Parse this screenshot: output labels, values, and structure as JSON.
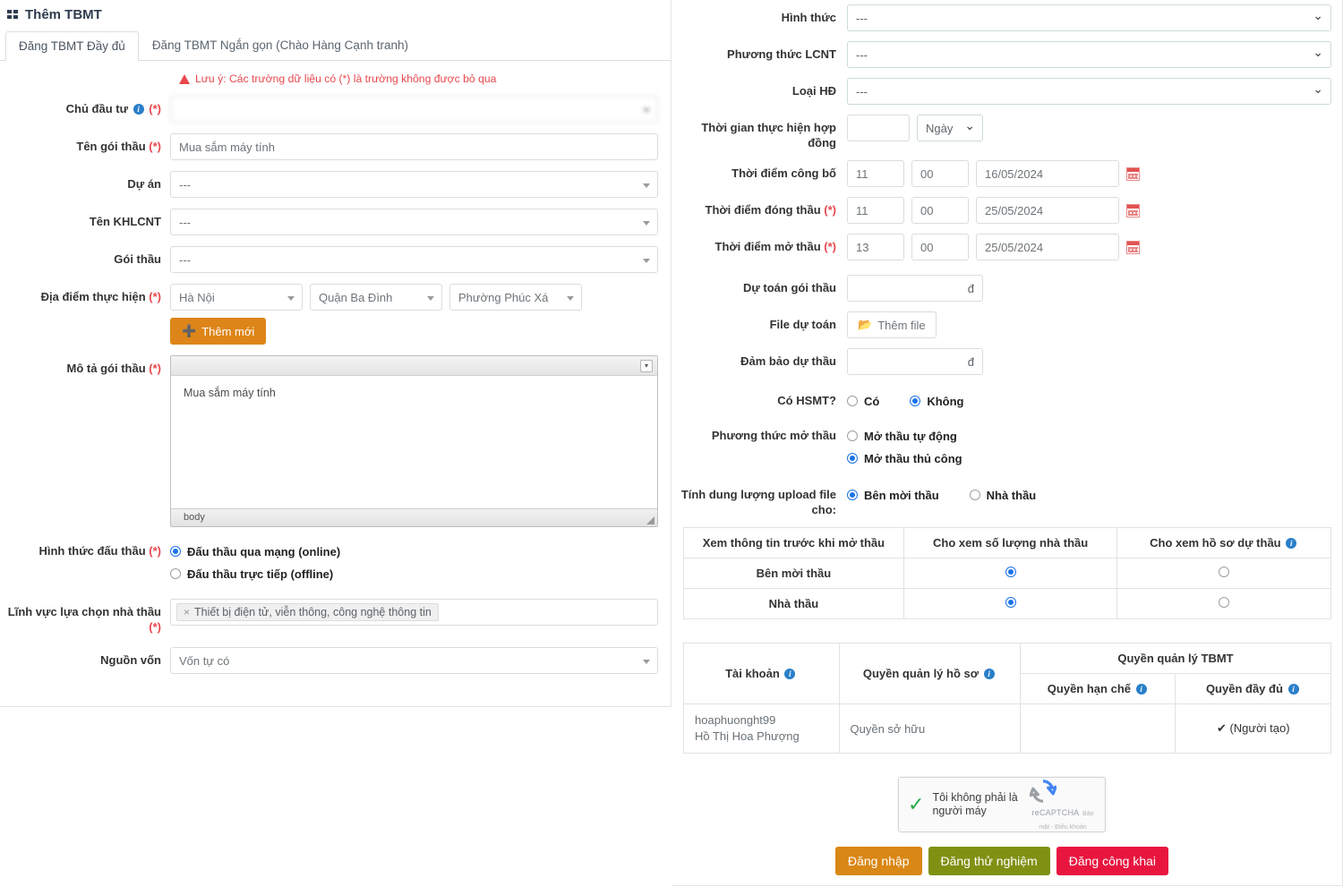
{
  "header": {
    "title": "Thêm TBMT",
    "icon": "grid-icon"
  },
  "tabs": [
    {
      "label": "Đăng TBMT Đầy đủ",
      "active": true
    },
    {
      "label": "Đăng TBMT Ngắn gọn (Chào Hàng Cạnh tranh)",
      "active": false
    }
  ],
  "notice": {
    "text": "Lưu ý: Các trường dữ liệu có (*) là trường không được bỏ qua",
    "color": "#e8474c"
  },
  "left_form": {
    "investor": {
      "label": "Chủ đầu tư",
      "required": "(*)",
      "value": "",
      "blurred": true
    },
    "package_name": {
      "label": "Tên gói thầu",
      "required": "(*)",
      "value": "Mua sắm máy tính"
    },
    "project": {
      "label": "Dự án",
      "value": "---"
    },
    "khlcnt_name": {
      "label": "Tên KHLCNT",
      "value": "---"
    },
    "package": {
      "label": "Gói thầu",
      "value": "---"
    },
    "location": {
      "label": "Địa điểm thực hiện",
      "required": "(*)",
      "province": "Hà Nội",
      "district": "Quận Ba Đình",
      "ward": "Phường Phúc Xá",
      "add_button": "Thêm mới"
    },
    "description": {
      "label": "Mô tả gói thầu",
      "required": "(*)",
      "value": "Mua sắm máy tính",
      "status_bar": "body"
    },
    "bidding_form": {
      "label": "Hình thức đấu thầu",
      "required": "(*)",
      "options": [
        {
          "label": "Đấu thầu qua mạng (online)",
          "selected": true
        },
        {
          "label": "Đấu thầu trực tiếp (offline)",
          "selected": false
        }
      ]
    },
    "field_selection": {
      "label": "Lĩnh vực lựa chọn nhà thầu",
      "required": "(*)",
      "tags": [
        "Thiết bị điện tử, viễn thông, công nghệ thông tin"
      ]
    },
    "capital_source": {
      "label": "Nguồn vốn",
      "value": "Vốn tự có"
    }
  },
  "right_form": {
    "form_type": {
      "label": "Hình thức",
      "value": "---"
    },
    "lcnt_method": {
      "label": "Phương thức LCNT",
      "value": "---"
    },
    "contract_type": {
      "label": "Loại HĐ",
      "value": "---"
    },
    "contract_duration": {
      "label": "Thời gian thực hiện hợp đồng",
      "value": "",
      "unit": "Ngày"
    },
    "publish_time": {
      "label": "Thời điểm công bố",
      "hour": "11",
      "minute": "00",
      "date": "16/05/2024"
    },
    "close_time": {
      "label": "Thời điểm đóng thầu",
      "required": "(*)",
      "hour": "11",
      "minute": "00",
      "date": "25/05/2024"
    },
    "open_time": {
      "label": "Thời điểm mở thầu",
      "required": "(*)",
      "hour": "13",
      "minute": "00",
      "date": "25/05/2024"
    },
    "estimate": {
      "label": "Dự toán gói thầu",
      "value": "",
      "currency": "đ"
    },
    "estimate_file": {
      "label": "File dự toán",
      "button": "Thêm file"
    },
    "bid_guarantee": {
      "label": "Đảm bảo dự thầu",
      "value": "",
      "currency": "đ"
    },
    "has_hsmt": {
      "label": "Có HSMT?",
      "options": [
        {
          "label": "Có",
          "selected": false
        },
        {
          "label": "Không",
          "selected": true
        }
      ]
    },
    "open_method": {
      "label": "Phương thức mở thầu",
      "options": [
        {
          "label": "Mở thầu tự động",
          "selected": false
        },
        {
          "label": "Mở thầu thủ công",
          "selected": true
        }
      ]
    },
    "upload_quota": {
      "label": "Tính dung lượng upload file cho:",
      "options": [
        {
          "label": "Bên mời thầu",
          "selected": true
        },
        {
          "label": "Nhà thầu",
          "selected": false
        }
      ]
    }
  },
  "visibility_table": {
    "headers": [
      "Xem thông tin trước khi mở thầu",
      "Cho xem số lượng nhà thầu",
      "Cho xem hồ sơ dự thầu"
    ],
    "header_info_icons": [
      false,
      false,
      true
    ],
    "rows": [
      {
        "name": "Bên mời thầu",
        "show_count": true,
        "show_docs": false
      },
      {
        "name": "Nhà thầu",
        "show_count": true,
        "show_docs": false
      }
    ]
  },
  "permission_table": {
    "col_account": "Tài khoản",
    "col_doc_permission": "Quyền quản lý hồ sơ",
    "col_tbmt_group": "Quyền quản lý TBMT",
    "col_limited": "Quyền hạn chế",
    "col_full": "Quyền đầy đủ",
    "rows": [
      {
        "username": "hoaphuonght99",
        "fullname": "Hồ Thị Hoa Phượng",
        "doc_permission": "Quyền sở hữu",
        "limited": "",
        "full": "✔ (Người tạo)"
      }
    ]
  },
  "captcha": {
    "label": "Tôi không phải là người máy",
    "brand": "reCAPTCHA",
    "links": "Bảo mật - Điều khoản",
    "checked": true
  },
  "actions": [
    {
      "label": "Đăng nhập",
      "color": "#d98715"
    },
    {
      "label": "Đăng thử nghiệm",
      "color": "#7f9113"
    },
    {
      "label": "Đăng công khai",
      "color": "#e8153f"
    }
  ]
}
